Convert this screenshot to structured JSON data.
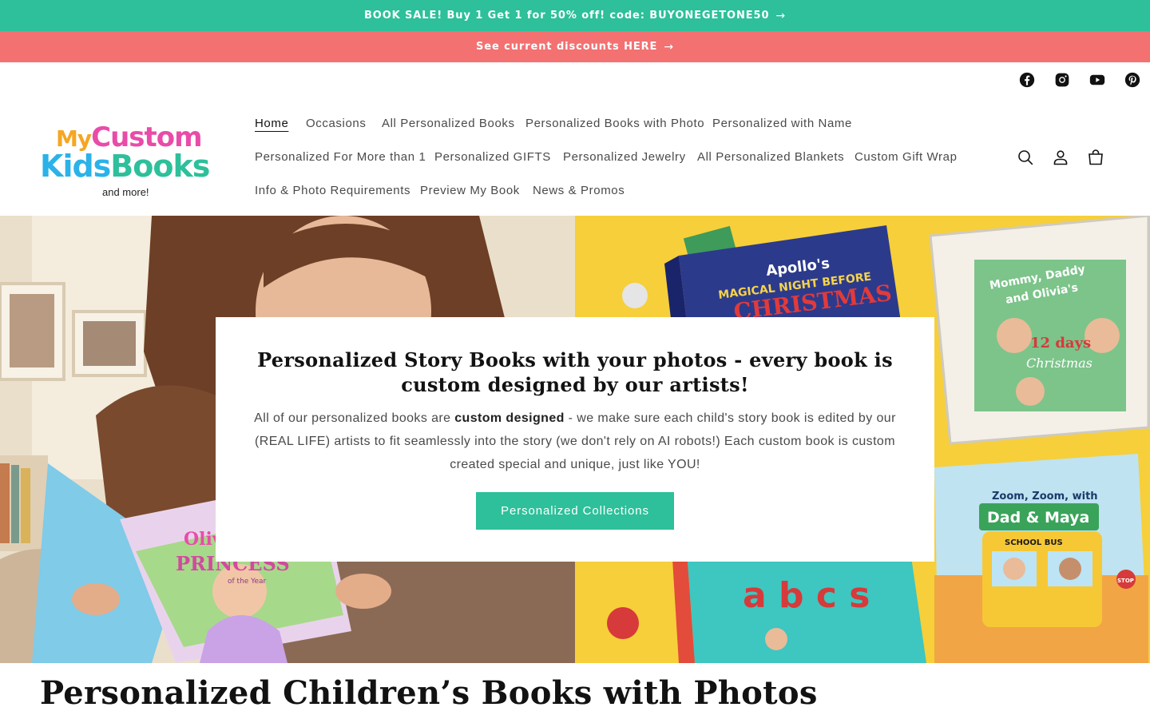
{
  "announcements": [
    {
      "text": "BOOK SALE! Buy 1 Get 1 for 50% off! code: BUYONEGETONE50",
      "arrow": "→",
      "color": "#2dc09a"
    },
    {
      "text": "See current discounts HERE",
      "arrow": "→",
      "color": "#f37171"
    }
  ],
  "social": [
    "facebook-icon",
    "instagram-icon",
    "youtube-icon",
    "pinterest-icon"
  ],
  "logo": {
    "word1": "My",
    "word2": "Custom",
    "word3": "Kids",
    "word4": "Books",
    "tagline": "and more!",
    "colors": {
      "my": "#f5a623",
      "custom": "#e94ca8",
      "kids": "#2bb2e8",
      "books": "#2dc09a"
    }
  },
  "nav": {
    "items": [
      "Home",
      "Occasions",
      "All Personalized Books",
      "Personalized Books with Photo",
      "Personalized with Name",
      "Personalized For More than 1",
      "Personalized GIFTS",
      "Personalized Jewelry",
      "All Personalized Blankets",
      "Custom Gift Wrap",
      "Info & Photo Requirements",
      "Preview My Book",
      "News & Promos"
    ],
    "active": "Home"
  },
  "header_icons": [
    "search-icon",
    "account-icon",
    "cart-icon"
  ],
  "hero": {
    "left_book": {
      "name": "Olivi",
      "title": "PRINCESS",
      "subtitle": "of the Year"
    },
    "book_christmas": {
      "line1": "Apollo's",
      "line2": "MAGICAL NIGHT BEFORE",
      "line3": "CHRISTMAS"
    },
    "book_days": {
      "line1": "Mommy, Daddy",
      "line2": "and Olivia's",
      "line3": "12 days",
      "line4": "Christmas"
    },
    "book_bus": {
      "line1": "Zoom, Zoom, with",
      "line2": "Dad & Maya",
      "sign": "SCHOOL BUS",
      "stop": "STOP"
    },
    "book_abc": {
      "letters": "a b c s"
    },
    "panel": {
      "heading": "Personalized Story Books with your photos - every book is custom designed by our artists!",
      "body_before": "All of our personalized books are ",
      "body_bold": "custom designed",
      "body_after": " - we make sure each child's story book is edited by our (REAL LIFE) artists to fit seamlessly into the story (we don't rely on AI robots!) Each custom book is custom created special and unique, just like YOU!",
      "button": "Personalized Collections"
    }
  },
  "section_title": "Personalized Children’s Books with Photos",
  "colors": {
    "accent": "#2dc09a",
    "promo": "#f37171",
    "text": "#121212"
  }
}
